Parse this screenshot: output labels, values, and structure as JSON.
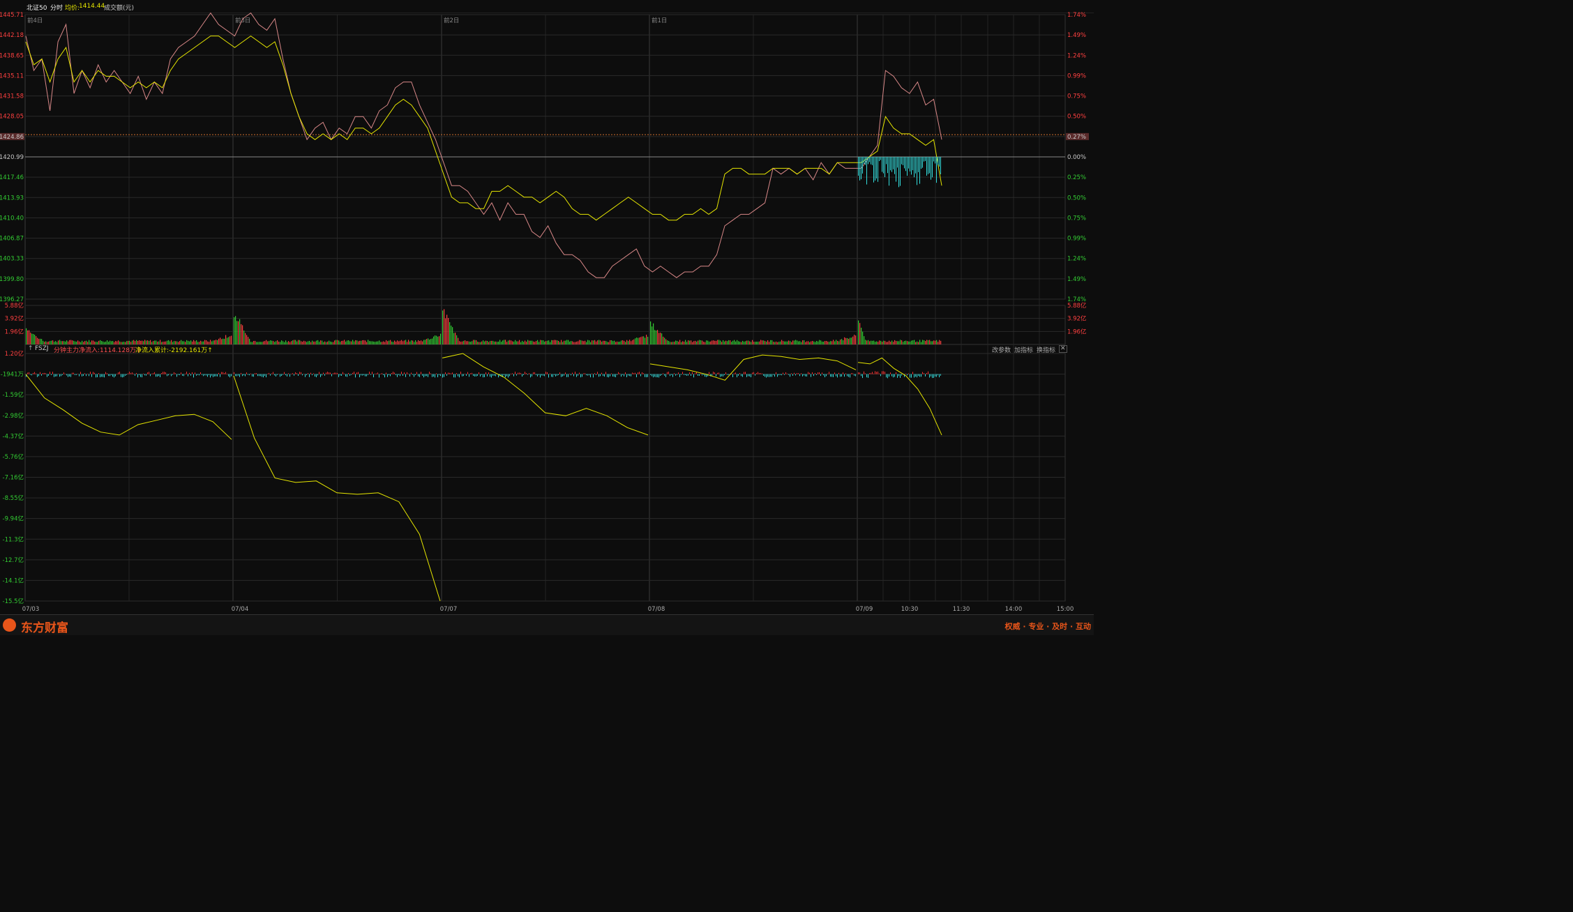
{
  "header": {
    "symbol": "北证50",
    "mode": "分时",
    "avg_label": "均价:",
    "avg_value": "1414.44",
    "amount_label": "成交额(元)"
  },
  "indicator": {
    "toggle": "↑",
    "name": "FSZJ",
    "minute_flow": "分钟主力净流入:1114.128万↓",
    "cum_flow": "净流入累计:-2192.161万↑",
    "buttons": [
      "改参数",
      "加指标",
      "换指标"
    ],
    "close": "✕"
  },
  "footer": {
    "brand": "东方财富",
    "slogan": "权威 · 专业 · 及时 · 互动"
  },
  "colors": {
    "up": "#ff4040",
    "down": "#33cc33",
    "price": "#d98888",
    "avg": "#e6e600",
    "flow_pos": "#ff3030",
    "flow_neg": "#33dddd",
    "grid": "#2a2a2a"
  },
  "chart_data": [
    {
      "type": "line",
      "panel": "price",
      "day_labels": [
        "前4日",
        "前3日",
        "前2日",
        "前1日"
      ],
      "left_ticks": [
        "1445.71",
        "1442.18",
        "1438.65",
        "1435.11",
        "1431.58",
        "1428.05",
        "1424.86",
        "1420.99",
        "1417.46",
        "1413.93",
        "1410.40",
        "1406.87",
        "1403.33",
        "1399.80",
        "1396.27"
      ],
      "right_ticks": [
        "1.74%",
        "1.49%",
        "1.24%",
        "0.99%",
        "0.75%",
        "0.50%",
        "0.27%",
        "0.00%",
        "0.25%",
        "0.50%",
        "0.75%",
        "0.99%",
        "1.24%",
        "1.49%",
        "1.74%"
      ],
      "prev_close": 1420.99,
      "current": 1424.86,
      "ylim": [
        1396.27,
        1445.71
      ],
      "series": [
        {
          "name": "价格",
          "values": [
            1442,
            1436,
            1438,
            1429,
            1441,
            1444,
            1432,
            1436,
            1433,
            1437,
            1434,
            1436,
            1434,
            1432,
            1435,
            1431,
            1434,
            1432,
            1438,
            1440,
            1441,
            1442,
            1444,
            1446,
            1444,
            1443,
            1442,
            1445,
            1446,
            1444,
            1443,
            1445,
            1438,
            1432,
            1428,
            1424,
            1426,
            1427,
            1424,
            1426,
            1425,
            1428,
            1428,
            1426,
            1429,
            1430,
            1433,
            1434,
            1434,
            1430,
            1427,
            1424,
            1420,
            1416,
            1416,
            1415,
            1413,
            1411,
            1413,
            1410,
            1413,
            1411,
            1411,
            1408,
            1407,
            1409,
            1406,
            1404,
            1404,
            1403,
            1401,
            1400,
            1400,
            1402,
            1403,
            1404,
            1405,
            1402,
            1401,
            1402,
            1401,
            1400,
            1401,
            1401,
            1402,
            1402,
            1404,
            1409,
            1410,
            1411,
            1411,
            1412,
            1413,
            1419,
            1418,
            1419,
            1418,
            1419,
            1417,
            1420,
            1418,
            1420,
            1419,
            1419,
            1419,
            1421,
            1423,
            1436,
            1435,
            1433,
            1432,
            1434,
            1430,
            1431,
            1424
          ]
        },
        {
          "name": "均价",
          "values": [
            1441,
            1437,
            1438,
            1434,
            1438,
            1440,
            1434,
            1436,
            1434,
            1436,
            1435,
            1435,
            1434,
            1433,
            1434,
            1433,
            1434,
            1433,
            1436,
            1438,
            1439,
            1440,
            1441,
            1442,
            1442,
            1441,
            1440,
            1441,
            1442,
            1441,
            1440,
            1441,
            1437,
            1432,
            1428,
            1425,
            1424,
            1425,
            1424,
            1425,
            1424,
            1426,
            1426,
            1425,
            1426,
            1428,
            1430,
            1431,
            1430,
            1428,
            1426,
            1422,
            1418,
            1414,
            1413,
            1413,
            1412,
            1412,
            1415,
            1415,
            1416,
            1415,
            1414,
            1414,
            1413,
            1414,
            1415,
            1414,
            1412,
            1411,
            1411,
            1410,
            1411,
            1412,
            1413,
            1414,
            1413,
            1412,
            1411,
            1411,
            1410,
            1410,
            1411,
            1411,
            1412,
            1411,
            1412,
            1418,
            1419,
            1419,
            1418,
            1418,
            1418,
            1419,
            1419,
            1419,
            1418,
            1419,
            1419,
            1419,
            1418,
            1420,
            1420,
            1420,
            1420,
            1421,
            1422,
            1428,
            1426,
            1425,
            1425,
            1424,
            1423,
            1424,
            1416
          ]
        }
      ]
    },
    {
      "type": "bar",
      "panel": "volume",
      "ticks": [
        "5.88亿",
        "3.92亿",
        "1.96亿"
      ],
      "ylim": [
        0,
        5.88
      ],
      "day_spikes": [
        2.2,
        4.9,
        5.5,
        3.2,
        4.2
      ]
    },
    {
      "type": "line",
      "panel": "fund_flow",
      "ticks": [
        "1.20亿",
        "-1941万",
        "-1.59亿",
        "-2.98亿",
        "-4.37亿",
        "-5.76亿",
        "-7.16亿",
        "-8.55亿",
        "-9.94亿",
        "-11.3亿",
        "-12.7亿",
        "-14.1亿",
        "-15.5亿"
      ],
      "ylim": [
        -15.5,
        1.2
      ],
      "x_labels": [
        "07/03",
        "07/04",
        "07/07",
        "07/08",
        "07/09",
        "10:30",
        "11:30",
        "14:00",
        "15:00"
      ],
      "series": [
        {
          "name": "净流入累计",
          "values": [
            -0.2,
            -1.8,
            -2.6,
            -3.5,
            -4.1,
            -4.3,
            -3.6,
            -3.3,
            -3.0,
            -2.9,
            -3.4,
            -4.6,
            -0.3,
            -4.5,
            -7.2,
            -7.5,
            -7.4,
            -8.2,
            -8.3,
            -8.2,
            -8.8,
            -11.0,
            -15.5,
            0.9,
            1.2,
            0.3,
            -0.4,
            -1.5,
            -2.8,
            -3.0,
            -2.5,
            -3.0,
            -3.8,
            -4.3,
            0.5,
            0.3,
            0.1,
            -0.2,
            -0.6,
            0.8,
            1.1,
            1.0,
            0.8,
            0.9,
            0.7,
            0.1,
            0.6,
            0.5,
            0.9,
            0.2,
            -0.3,
            -1.2,
            -2.5,
            -4.3
          ]
        },
        {
          "name": "分钟主力净流入",
          "values": [
            0.1,
            -0.2,
            -0.1,
            0.05,
            -0.15,
            0.1,
            -0.2,
            0.1,
            -0.1,
            0.05
          ]
        }
      ]
    }
  ]
}
